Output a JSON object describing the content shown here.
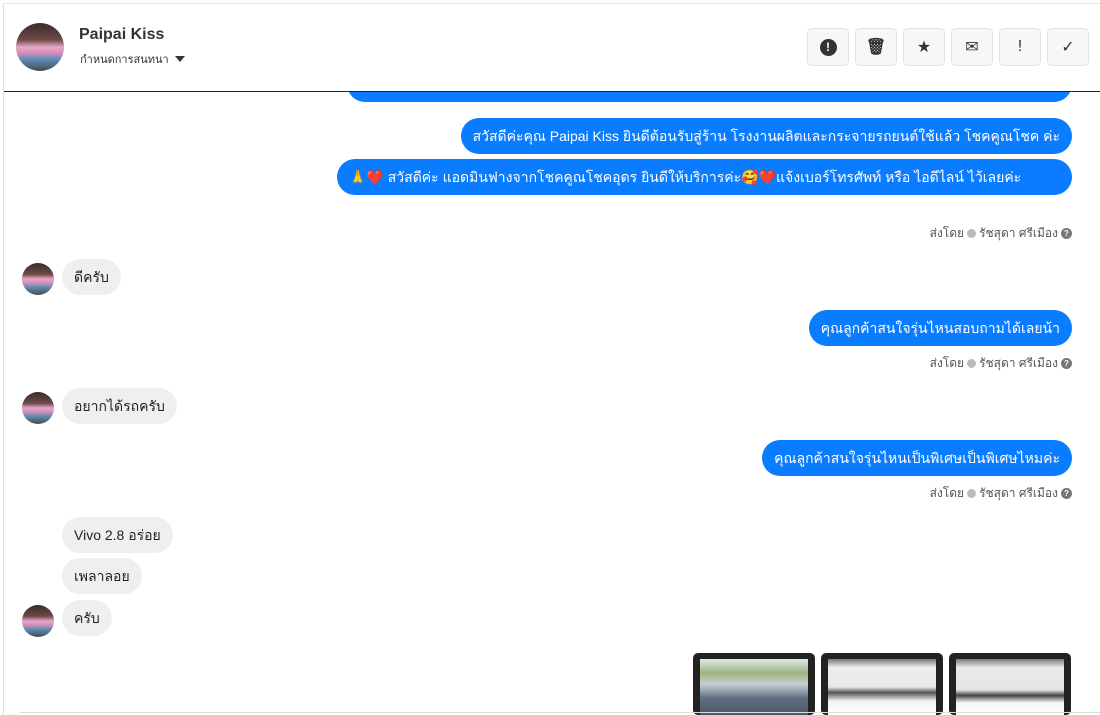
{
  "header": {
    "contact_name": "Paipai Kiss",
    "assign_label": "กำหนดการสนทนา",
    "tools": [
      {
        "icon": "alert-circle-icon",
        "glyph": "!"
      },
      {
        "icon": "trash-icon",
        "glyph": "🗑"
      },
      {
        "icon": "star-icon",
        "glyph": "★"
      },
      {
        "icon": "envelope-icon",
        "glyph": "✉"
      },
      {
        "icon": "exclamation-icon",
        "glyph": "!"
      },
      {
        "icon": "check-icon",
        "glyph": "✓"
      }
    ]
  },
  "messages": [
    {
      "dir": "out",
      "text": "สวัสดีค่ะคุณ Paipai Kiss ยินดีต้อนรับสู่ร้าน โรงงานผลิตและกระจายรถยนต์ใช้แล้ว โชคคูณโชค ค่ะ"
    },
    {
      "dir": "out",
      "text": "🙏❤️ สวัสดีค่ะ แอดมินฟางจากโชคคูณโชคอุดร ยินดีให้บริการค่ะ🥰❤️แจ้งเบอร์โทรศัพท์ หรือ ไอดีไลน์  ไว้เลยค่ะ"
    },
    {
      "dir": "in",
      "text": "ดีครับ"
    },
    {
      "dir": "out",
      "text": "คุณลูกค้าสนใจรุ่นไหนสอบถามได้เลยน้า"
    },
    {
      "dir": "in",
      "text": "อยากได้รถครับ"
    },
    {
      "dir": "out",
      "text": "คุณลูกค้าสนใจรุ่นไหนเป็นพิเศษเป็นพิเศษไหมค่ะ"
    },
    {
      "dir": "in",
      "text": "Vivo 2.8 อร่อย"
    },
    {
      "dir": "in",
      "text": "เพลาลอย"
    },
    {
      "dir": "in",
      "text": "ครับ"
    }
  ],
  "meta": {
    "sent_by": "ส่งโดย",
    "agent": "รัชสุดา ศรีเมือง"
  }
}
